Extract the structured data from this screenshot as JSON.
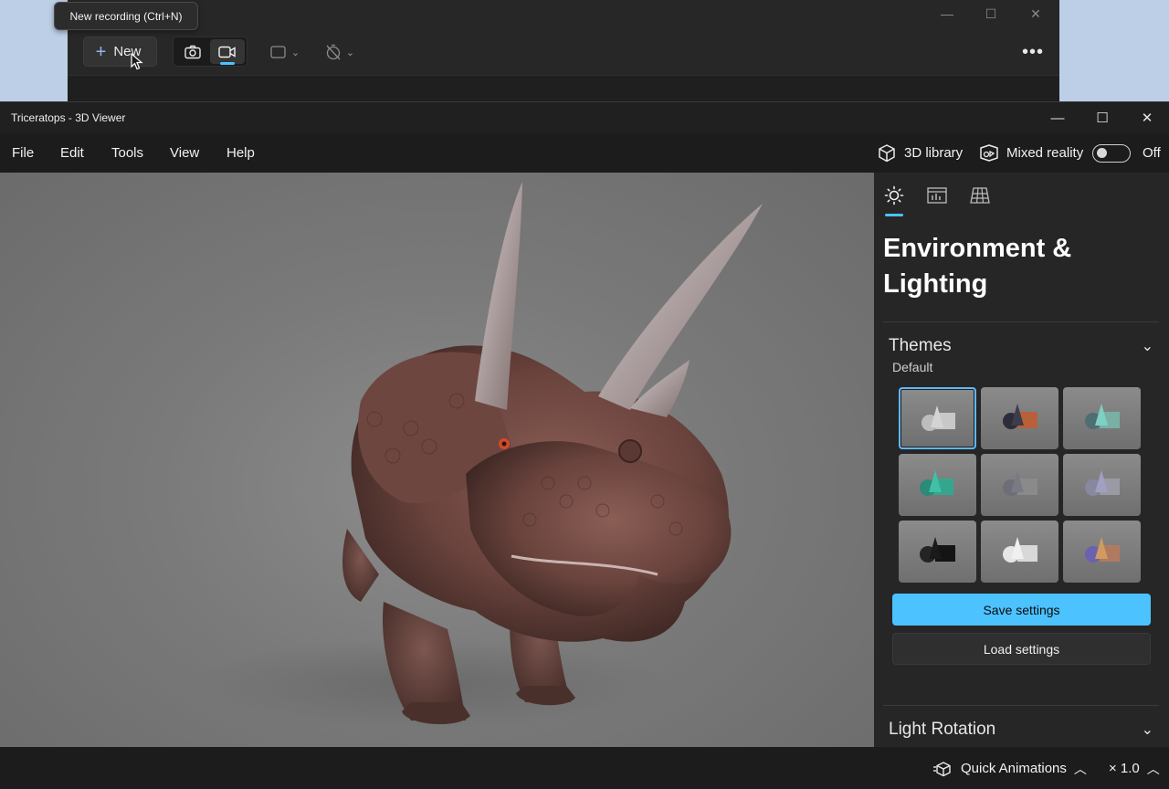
{
  "snip": {
    "new_label": "New",
    "tooltip": "New recording (Ctrl+N)",
    "more_label": "•••",
    "controls": {
      "minimize": "—",
      "maximize": "☐",
      "close": "✕"
    }
  },
  "viewer": {
    "window_title": "Triceratops - 3D Viewer",
    "controls": {
      "minimize": "—",
      "maximize": "☐",
      "close": "✕"
    },
    "menu": [
      "File",
      "Edit",
      "Tools",
      "View",
      "Help"
    ],
    "library_label": "3D library",
    "mixed_reality_label": "Mixed reality",
    "toggle_state": "Off",
    "panel": {
      "title": "Environment & Lighting",
      "themes_header": "Themes",
      "default_label": "Default",
      "save_label": "Save settings",
      "load_label": "Load settings",
      "light_rotation_header": "Light Rotation"
    },
    "status": {
      "quick_animations": "Quick Animations",
      "speed": "× 1.0"
    }
  },
  "colors": {
    "accent": "#4cc2ff",
    "titlebar": "#202020",
    "viewport": "#7a7a7a"
  }
}
